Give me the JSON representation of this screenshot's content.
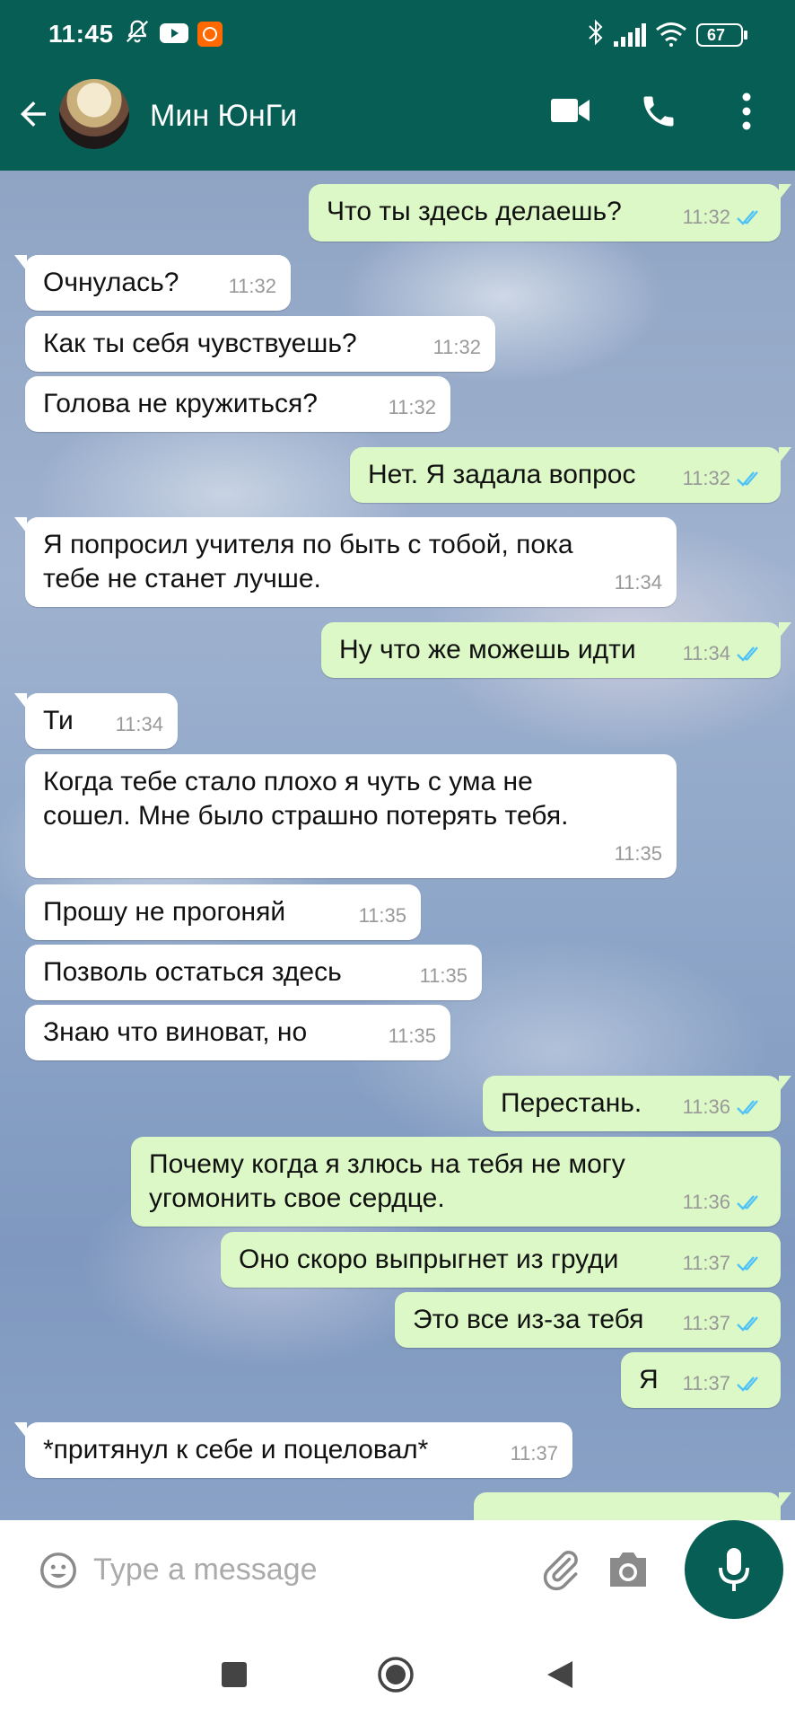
{
  "status_bar": {
    "time": "11:45",
    "battery": "67"
  },
  "header": {
    "contact_name": "Мин ЮнГи"
  },
  "messages": [
    {
      "dir": "out",
      "text": "Что ты здесь делаешь?",
      "time": "11:32"
    },
    {
      "dir": "in",
      "text": "Очнулась?",
      "time": "11:32"
    },
    {
      "dir": "in",
      "text": "Как ты себя чувствуешь?",
      "time": "11:32"
    },
    {
      "dir": "in",
      "text": "Голова не кружиться?",
      "time": "11:32"
    },
    {
      "dir": "out",
      "text": "Нет. Я задала вопрос",
      "time": "11:32"
    },
    {
      "dir": "in",
      "text": "Я попросил учителя по быть с тобой, пока тебе не станет лучше.",
      "time": "11:34"
    },
    {
      "dir": "out",
      "text": "Ну что же можешь идти",
      "time": "11:34"
    },
    {
      "dir": "in",
      "text": "Ти",
      "time": "11:34"
    },
    {
      "dir": "in",
      "text": "Когда тебе стало плохо я чуть с ума не сошел. Мне было страшно потерять тебя.",
      "time": "11:35"
    },
    {
      "dir": "in",
      "text": "Прошу не прогоняй",
      "time": "11:35"
    },
    {
      "dir": "in",
      "text": "Позволь остаться здесь",
      "time": "11:35"
    },
    {
      "dir": "in",
      "text": "Знаю что виноват, но",
      "time": "11:35"
    },
    {
      "dir": "out",
      "text": "Перестань.",
      "time": "11:36"
    },
    {
      "dir": "out",
      "text": "Почему когда я злюсь на тебя не могу угомонить свое сердце.",
      "time": "11:36"
    },
    {
      "dir": "out",
      "text": "Оно скоро выпрыгнет из груди",
      "time": "11:37"
    },
    {
      "dir": "out",
      "text": "Это все из-за тебя",
      "time": "11:37"
    },
    {
      "dir": "out",
      "text": "Я",
      "time": "11:37"
    },
    {
      "dir": "in",
      "text": "*притянул к себе и поцеловал*",
      "time": "11:37"
    }
  ],
  "input": {
    "placeholder": "Type a message"
  },
  "colors": {
    "header": "#075e54",
    "outgoing_bubble": "#dcf8c6",
    "incoming_bubble": "#ffffff",
    "read_ticks": "#4fc3f7"
  }
}
